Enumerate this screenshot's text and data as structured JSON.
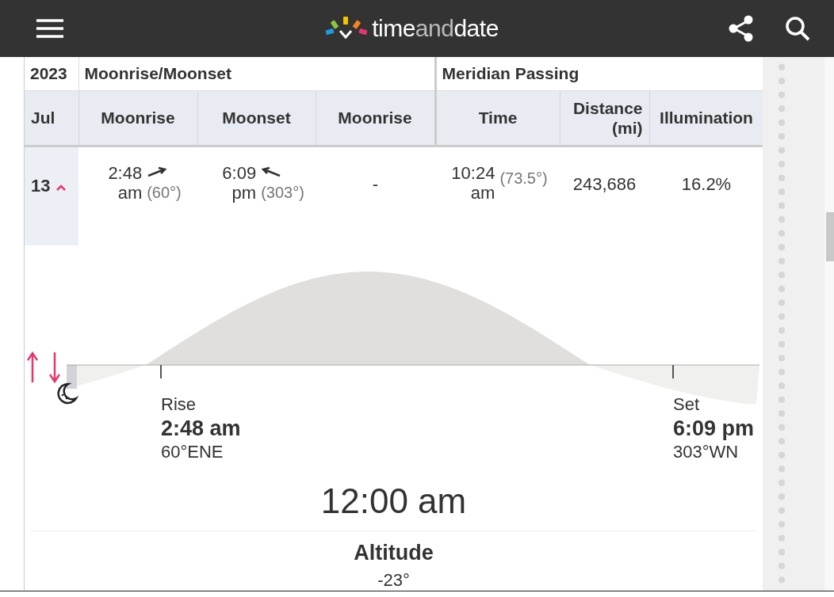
{
  "header": {
    "logo_parts": [
      "time",
      "and",
      "date"
    ]
  },
  "table": {
    "groups": [
      "2023",
      "Moonrise/Moonset",
      "Meridian Passing"
    ],
    "columns": [
      "Jul",
      "Moonrise",
      "Moonset",
      "Moonrise",
      "Time",
      "Distance (mi)",
      "Illumination"
    ],
    "rows": [
      {
        "cells": [
          {
            "kind": "day",
            "text": "13",
            "expanded": true
          },
          {
            "kind": "rise",
            "time": "2:48 am",
            "angle": "(60°)"
          },
          {
            "kind": "set",
            "time": "6:09 pm",
            "angle": "(303°)"
          },
          {
            "kind": "plain",
            "text": "-"
          },
          {
            "kind": "transit",
            "time": "10:24 am",
            "angle": "(73.5°)"
          },
          {
            "kind": "plain",
            "text": "243,686"
          },
          {
            "kind": "plain",
            "text": "16.2%"
          }
        ]
      }
    ]
  },
  "detail": {
    "rise": {
      "label": "Rise",
      "time": "2:48 am",
      "azimuth": "60°ENE"
    },
    "set": {
      "label": "Set",
      "time": "6:09 pm",
      "azimuth": "303°WN"
    },
    "current_time": "12:00 am",
    "altitude": {
      "label": "Altitude",
      "value": "-23°"
    }
  }
}
